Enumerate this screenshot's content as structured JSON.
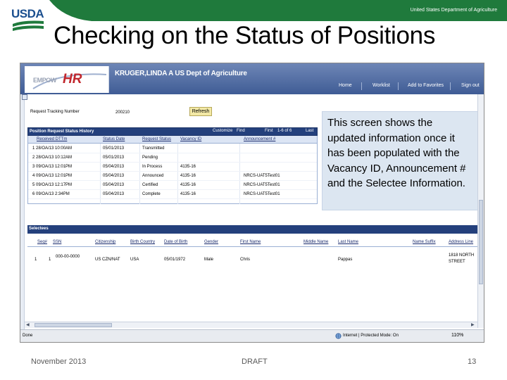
{
  "slide": {
    "usda_wordmark": "USDA",
    "usda_tagline": "United States Department of Agriculture",
    "title": "Checking on the Status of Positions",
    "footer_date": "November 2013",
    "footer_draft": "DRAFT",
    "footer_page": "13"
  },
  "colors": {
    "usda_green": "#1f7a3c",
    "usda_blue": "#1b4f8f",
    "banner_blue": "#3f5c95",
    "grid_header": "#24407c",
    "refresh_yellow": "#f3e9a6",
    "callout_bg": "#dce6f1"
  },
  "app": {
    "logo_text_1": "EMPOW",
    "logo_text_2": "HR",
    "user_org": "KRUGER,LINDA A  US Dept of Agriculture",
    "nav": [
      "Home",
      "Worklist",
      "Add to Favorites",
      "Sign out"
    ],
    "request_label": "Request Tracking Number",
    "request_value": "200210",
    "refresh_label": "Refresh"
  },
  "history": {
    "title": "Position Request Status History",
    "tools": {
      "customize": "Customize",
      "find": "Find",
      "first": "First",
      "page_info": "1-6 of 6",
      "last": "Last"
    },
    "columns": [
      "Received DTTm",
      "Status Date",
      "Request Status",
      "Vacancy ID",
      "Announcement #"
    ],
    "rows": [
      {
        "received": "1 28/OA/13 10:00AM",
        "date": "05/01/2013",
        "status": "Transmitted",
        "vacancy": "",
        "announcement": ""
      },
      {
        "received": "2 28/OA/13 10:12AM",
        "date": "05/01/2013",
        "status": "Pending",
        "vacancy": "",
        "announcement": ""
      },
      {
        "received": "3 09/OA/13 12:01PM",
        "date": "05/04/2013",
        "status": "In Process",
        "vacancy": "4135-16",
        "announcement": ""
      },
      {
        "received": "4 09/OA/13 12:01PM",
        "date": "05/04/2013",
        "status": "Announced",
        "vacancy": "4135-16",
        "announcement": "NRCS-UAT5Test01"
      },
      {
        "received": "5 09/OA/13 12:17PM",
        "date": "05/04/2013",
        "status": "Certified",
        "vacancy": "4135-16",
        "announcement": "NRCS-UAT5Test01"
      },
      {
        "received": "6 09/OA/13 2:34PM",
        "date": "05/04/2013",
        "status": "Complete",
        "vacancy": "4135-16",
        "announcement": "NRCS-UAT5Test01"
      }
    ]
  },
  "callout": {
    "text": "This screen shows the updated information once it has been populated with the Vacancy ID, Announcement # and the Selectee Information."
  },
  "selectees": {
    "title": "Selectees",
    "columns": [
      "Seq#",
      "SSN",
      "Citizenship",
      "Birth Country",
      "Date of Birth",
      "Gender",
      "First Name",
      "Middle Name",
      "Last Name",
      "Name Suffix",
      "Address Line"
    ],
    "row": {
      "row_num": "1",
      "seq": "1",
      "ssn": "000-00-0000",
      "citizenship": "US CZN/NAT",
      "birth_country": "USA",
      "dob": "05/01/1972",
      "gender": "Male",
      "first_name": "Chris",
      "middle_name": "",
      "last_name": "Pappas",
      "suffix": "",
      "address": "1818 NORTH",
      "address2": "STREET"
    }
  },
  "statusbar": {
    "done": "Done",
    "zone": "Internet | Protected Mode: On",
    "zoom": "110%"
  },
  "icons": [
    "usda-logo-icon",
    "side-menu-icon",
    "globe-icon",
    "scroll-left-icon",
    "scroll-right-icon"
  ]
}
